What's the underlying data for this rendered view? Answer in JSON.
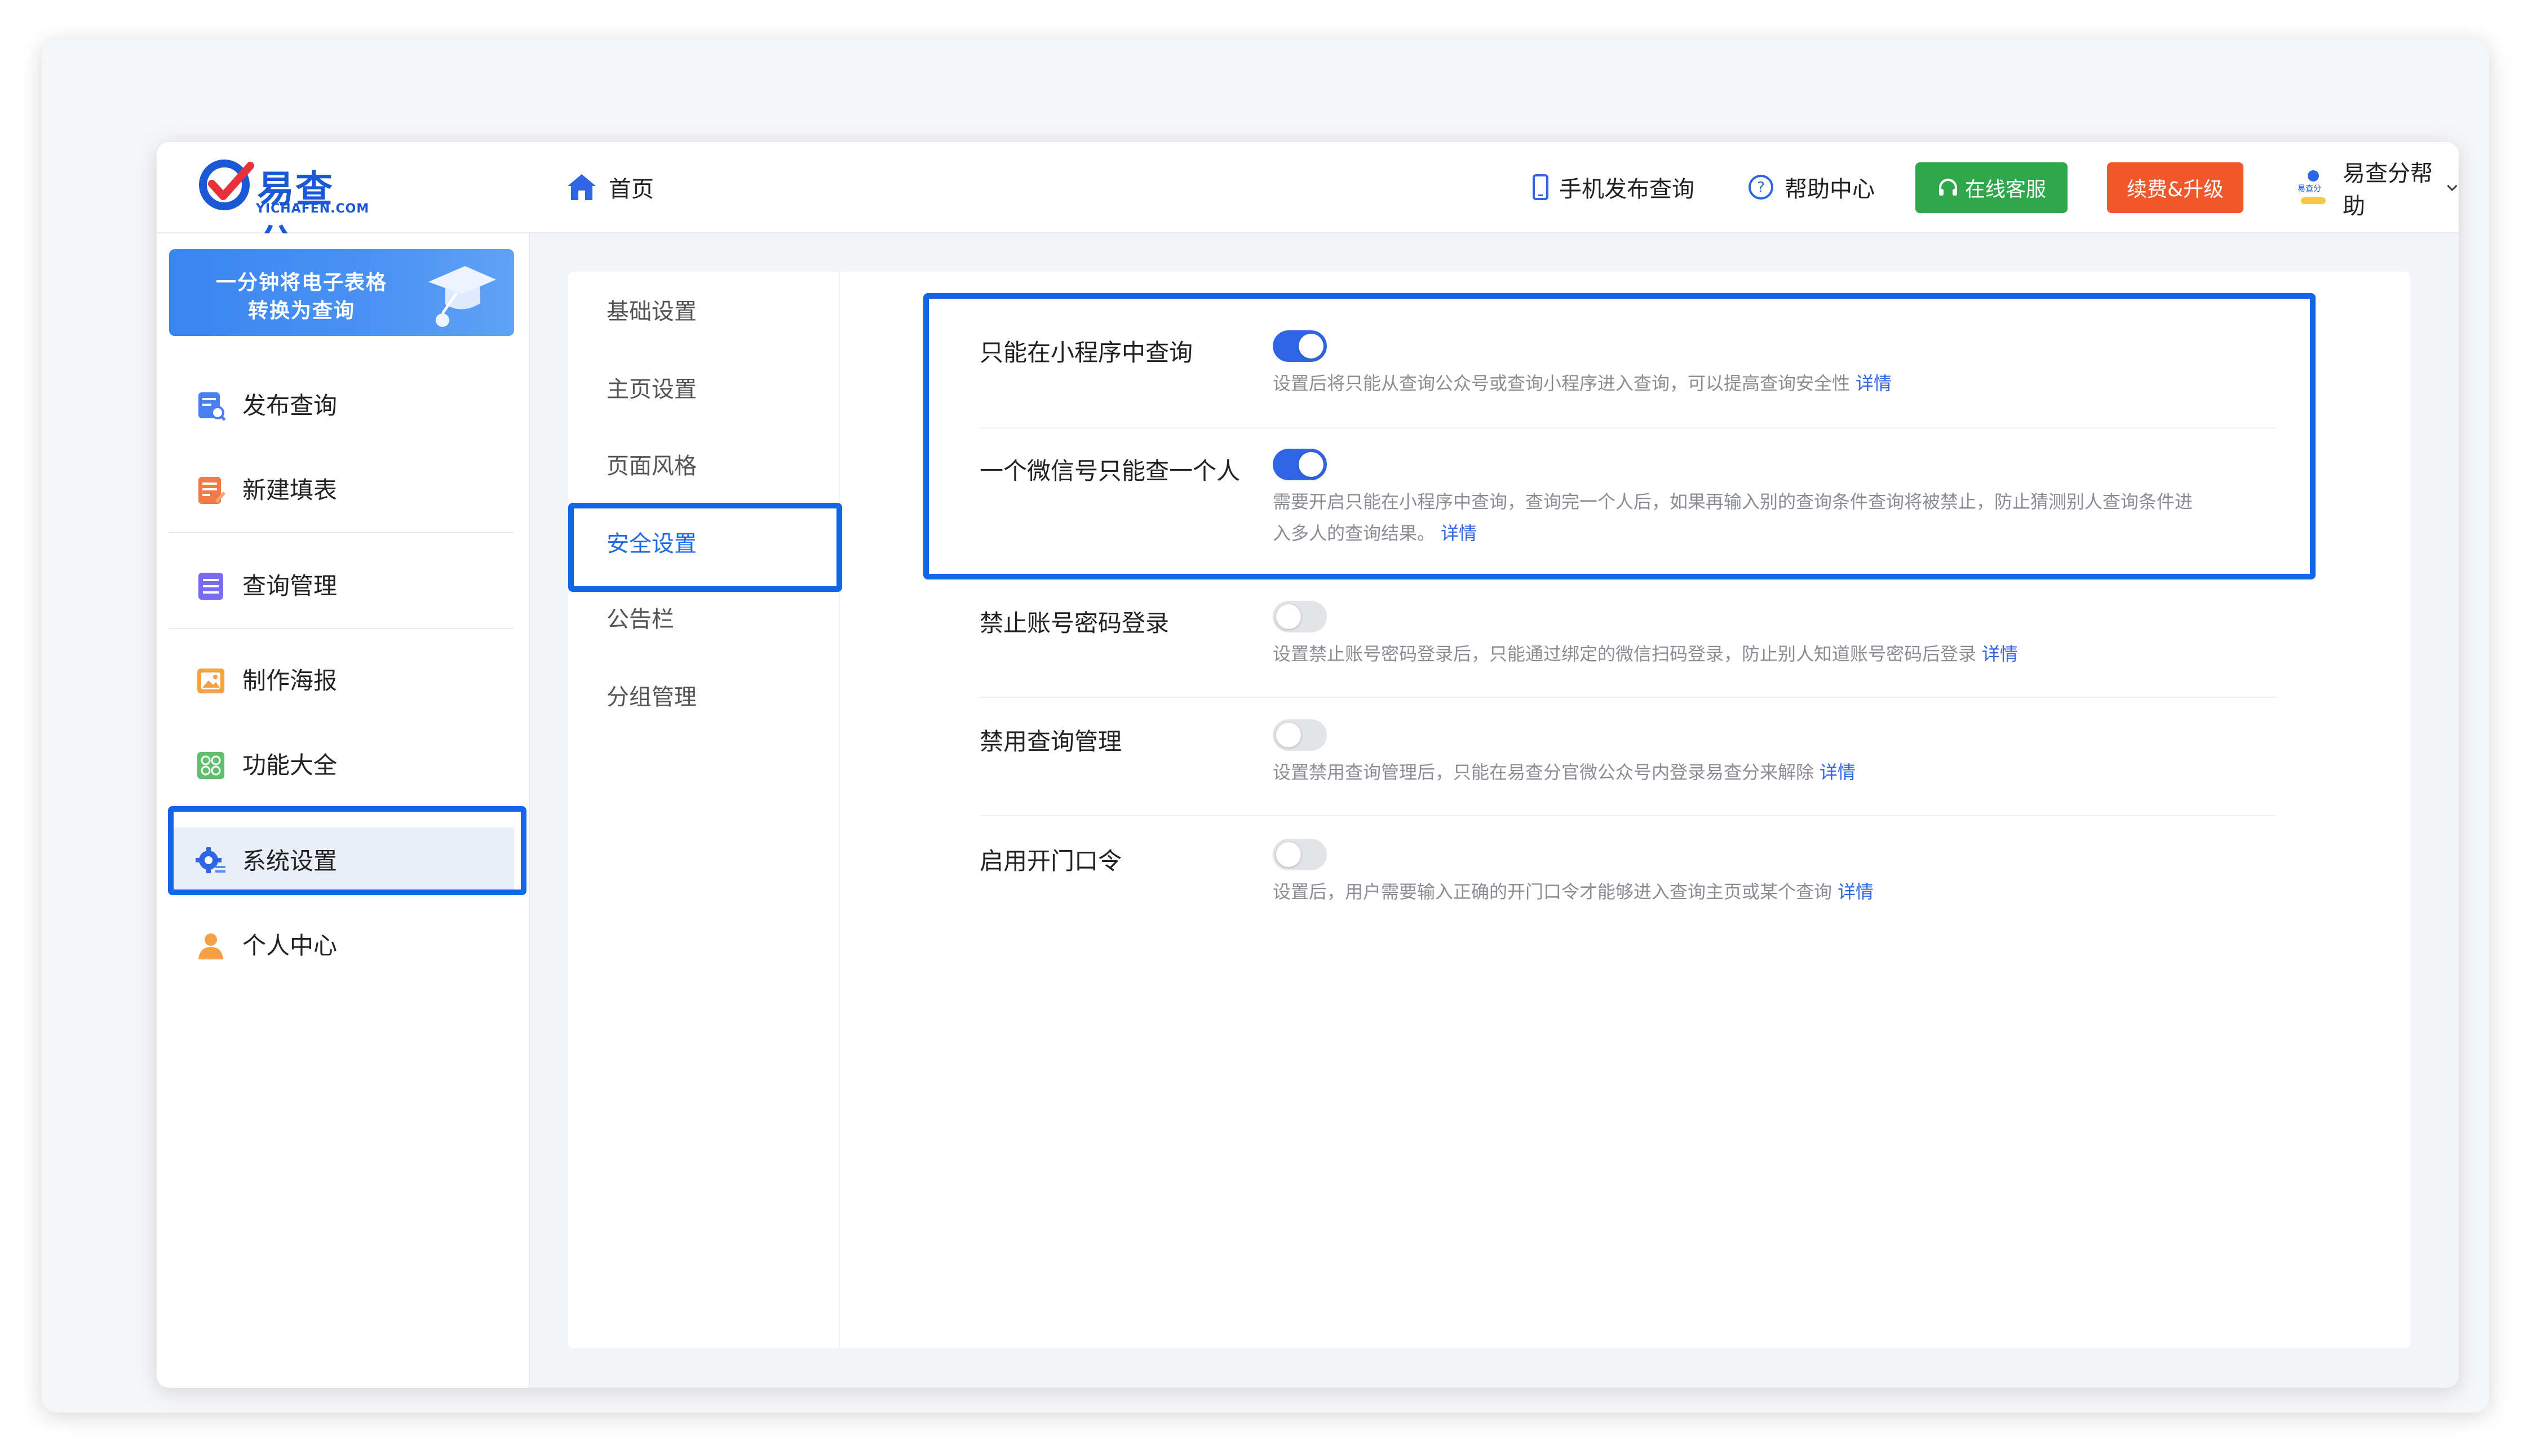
{
  "header": {
    "logo_text": "易查分",
    "logo_sub": "YICHAFEN.COM",
    "home_label": "首页",
    "mobile_publish_label": "手机发布查询",
    "help_center_label": "帮助中心",
    "online_service_label": "在线客服",
    "renew_label": "续费&升级",
    "user_name": "易查分帮助",
    "avatar_text": "易查分"
  },
  "sidebar": {
    "banner_line1": "一分钟将电子表格",
    "banner_line2": "转换为查询",
    "items": [
      {
        "label": "发布查询",
        "icon": "publish-query-icon"
      },
      {
        "label": "新建填表",
        "icon": "new-form-icon"
      },
      {
        "label": "查询管理",
        "icon": "query-management-icon"
      },
      {
        "label": "制作海报",
        "icon": "poster-icon"
      },
      {
        "label": "功能大全",
        "icon": "features-grid-icon"
      },
      {
        "label": "系统设置",
        "icon": "system-settings-icon"
      },
      {
        "label": "个人中心",
        "icon": "user-profile-icon"
      }
    ],
    "active_item": "系统设置"
  },
  "subnav": {
    "items": [
      "基础设置",
      "主页设置",
      "页面风格",
      "安全设置",
      "公告栏",
      "分组管理"
    ],
    "active": "安全设置"
  },
  "settings": [
    {
      "title": "只能在小程序中查询",
      "enabled": true,
      "description": "设置后将只能从查询公众号或查询小程序进入查询，可以提高查询安全性",
      "link": "详情"
    },
    {
      "title": "一个微信号只能查一个人",
      "enabled": true,
      "description_line1": "需要开启只能在小程序中查询，查询完一个人后，如果再输入别的查询条件查询将被禁止，防止猜测别人查询条件进",
      "description_line2": "入多人的查询结果。",
      "link": "详情"
    },
    {
      "title": "禁止账号密码登录",
      "enabled": false,
      "description": "设置禁止账号密码登录后，只能通过绑定的微信扫码登录，防止别人知道账号密码后登录",
      "link": "详情"
    },
    {
      "title": "禁用查询管理",
      "enabled": false,
      "description": "设置禁用查询管理后，只能在易查分官微公众号内登录易查分来解除",
      "link": "详情"
    },
    {
      "title": "启用开门口令",
      "enabled": false,
      "description": "设置后，用户需要输入正确的开门口令才能够进入查询主页或某个查询",
      "link": "详情"
    }
  ],
  "colors": {
    "accent": "#2f66e6",
    "highlight": "#1167e6",
    "green_button": "#2ea84a",
    "orange_button": "#f0582b"
  }
}
